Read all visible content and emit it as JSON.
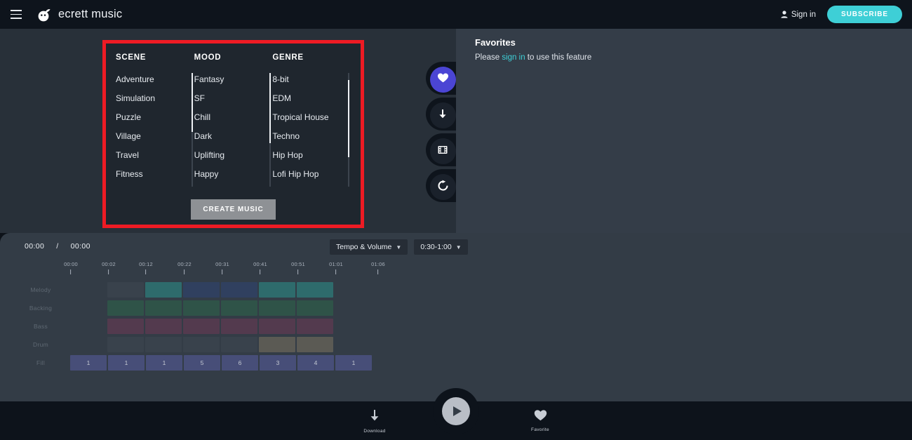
{
  "header": {
    "menu_icon": "hamburger-icon",
    "brand": "ecrett music",
    "signin_label": "Sign in",
    "subscribe_label": "SUBSCRIBE",
    "accent_teal": "#3ecfd6"
  },
  "selector": {
    "highlight_color": "#ee1b24",
    "columns": [
      {
        "title": "SCENE",
        "items": [
          "Adventure",
          "Simulation",
          "Puzzle",
          "Village",
          "Travel",
          "Fitness"
        ],
        "scroll_top_pct": 0,
        "scroll_size_pct": 52
      },
      {
        "title": "MOOD",
        "items": [
          "Fantasy",
          "SF",
          "Chill",
          "Dark",
          "Uplifting",
          "Happy"
        ],
        "scroll_top_pct": 0,
        "scroll_size_pct": 62
      },
      {
        "title": "GENRE",
        "items": [
          "8-bit",
          "EDM",
          "Tropical House",
          "Techno",
          "Hip Hop",
          "Lofi Hip Hop"
        ],
        "scroll_top_pct": 6,
        "scroll_size_pct": 68
      }
    ],
    "create_label": "CREATE MUSIC"
  },
  "rail": {
    "items": [
      {
        "name": "favorite-rail-button",
        "icon": "heart-icon",
        "active": true
      },
      {
        "name": "download-rail-button",
        "icon": "download-arrow-icon",
        "active": false
      },
      {
        "name": "video-rail-button",
        "icon": "film-strip-icon",
        "active": false
      },
      {
        "name": "refresh-rail-button",
        "icon": "refresh-icon",
        "active": false
      }
    ],
    "active_color": "#4b45d4"
  },
  "favorites": {
    "title": "Favorites",
    "message_prefix": "Please ",
    "link_label": "sign in",
    "message_suffix": " to use this feature"
  },
  "timeline": {
    "current_time": "00:00",
    "separator": "/",
    "total_time": "00:00",
    "selects": [
      {
        "label": "Tempo & Volume",
        "name": "tempo-volume-select"
      },
      {
        "label": "0:30-1:00",
        "name": "duration-select"
      }
    ],
    "ruler_ticks": [
      "00:00",
      "00:02",
      "00:12",
      "00:22",
      "00:31",
      "00:41",
      "00:51",
      "01:01",
      "01:06"
    ],
    "track_labels": [
      "Melody",
      "Backing",
      "Bass",
      "Drum",
      "Fill"
    ],
    "tracks": [
      {
        "label": "Melody",
        "clips": [
          "#39424c",
          "#2e6b6c",
          "#30405f",
          "#30405f",
          "#2e6b6c",
          "#2e6b6c"
        ]
      },
      {
        "label": "Backing",
        "clips": [
          "#2f5348",
          "#2f5348",
          "#2f5348",
          "#2f5348",
          "#2f5348",
          "#2f5348"
        ]
      },
      {
        "label": "Bass",
        "clips": [
          "#533a4e",
          "#533a4e",
          "#533a4e",
          "#533a4e",
          "#533a4e",
          "#533a4e"
        ]
      },
      {
        "label": "Drum",
        "clips": [
          "#39424c",
          "#39424c",
          "#39424c",
          "#39424c",
          "#5b5a54",
          "#5b5a54"
        ]
      }
    ],
    "fill_row": {
      "label": "Fill",
      "color": "#474e78",
      "values": [
        "1",
        "1",
        "1",
        "5",
        "6",
        "3",
        "4",
        "1"
      ]
    }
  },
  "player": {
    "download_label": "Download",
    "favorite_label": "Favorite",
    "play_icon": "play-icon"
  }
}
